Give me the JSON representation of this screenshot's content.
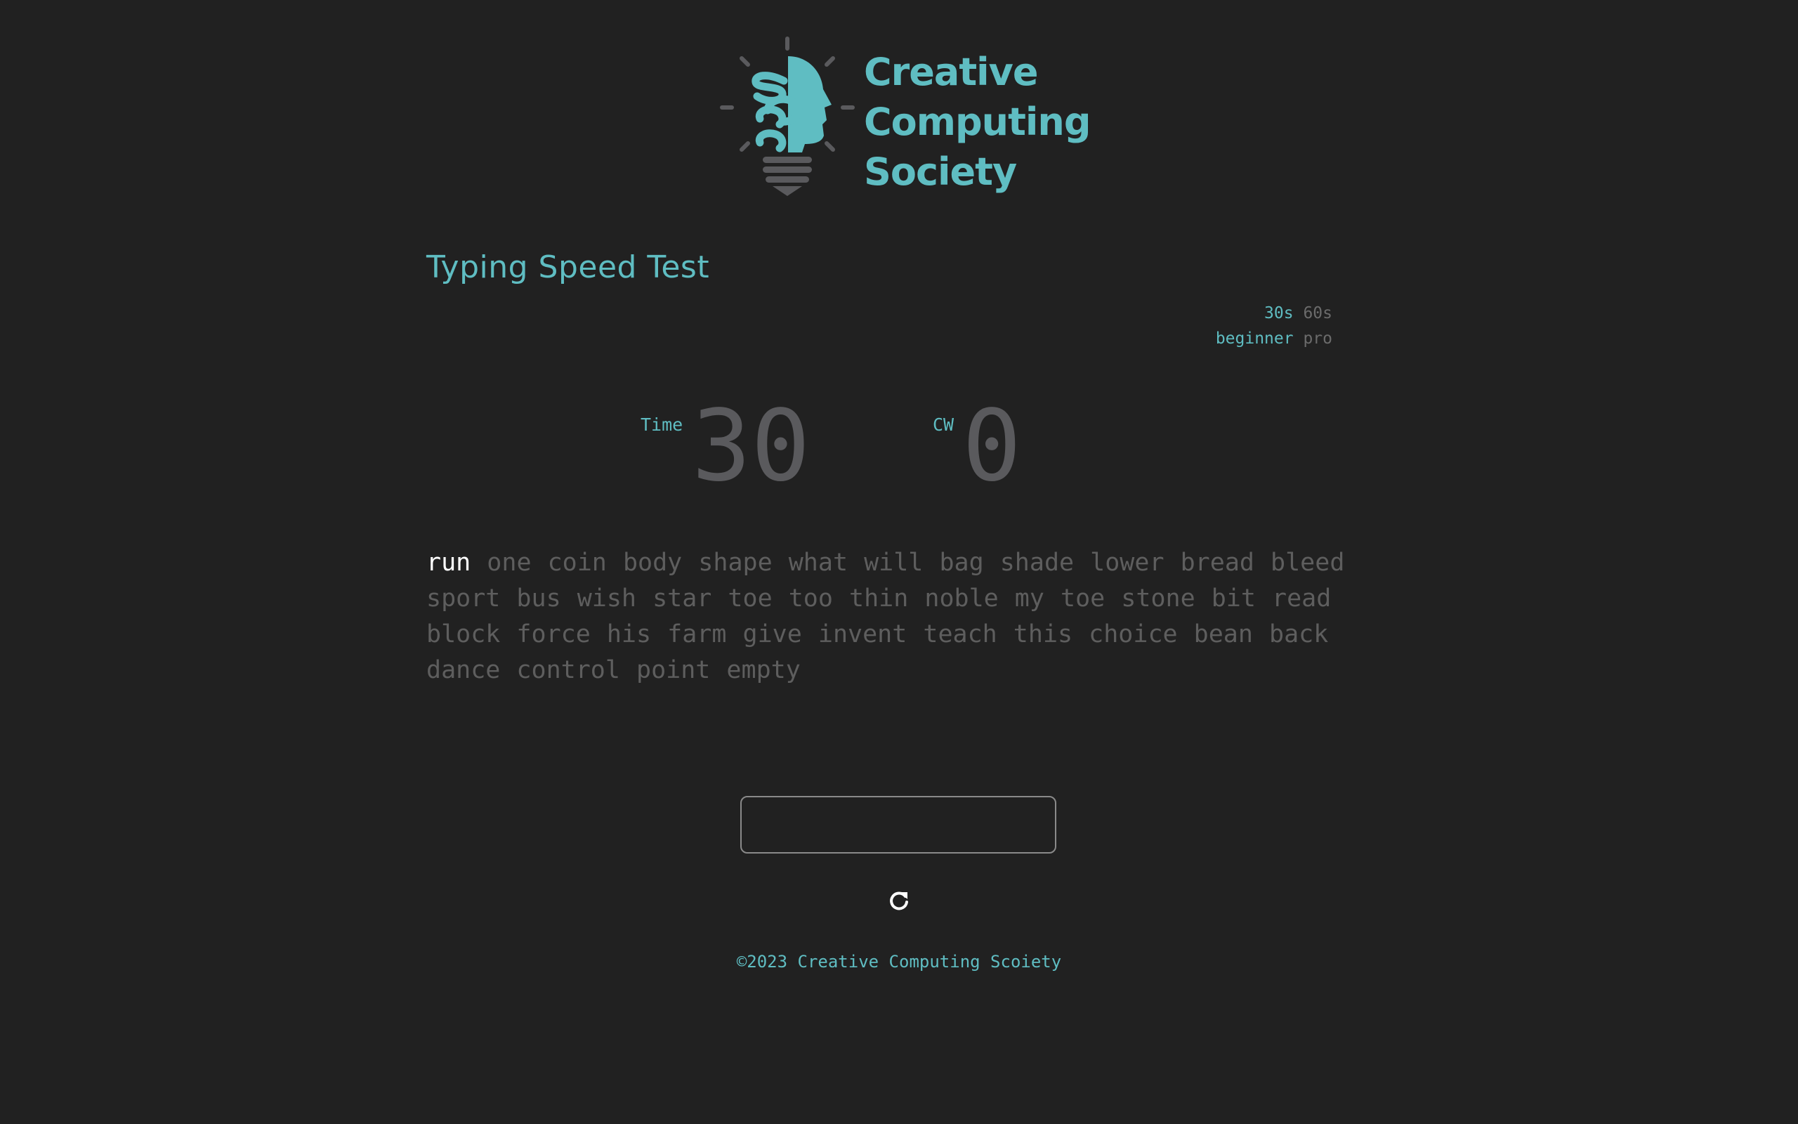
{
  "logo": {
    "icon": "lightbulb-head-icon",
    "mark": "CCS",
    "lines": [
      "Creative",
      "Computing",
      "Society"
    ]
  },
  "title": "Typing Speed Test",
  "options": {
    "durations": [
      "30s",
      "60s"
    ],
    "levels": [
      "beginner",
      "pro"
    ],
    "active_duration": "30s",
    "active_level": "beginner"
  },
  "stats": {
    "time_label": "Time",
    "time_value": "30",
    "cw_label": "CW",
    "cw_value": "0"
  },
  "words": {
    "current": "run",
    "remaining": "one coin body shape what will bag shade lower bread bleed sport bus wish star toe too thin noble my toe stone bit read block force his farm give invent teach this choice bean back dance control point empty"
  },
  "input": {
    "value": ""
  },
  "restart": {
    "icon": "restart-icon"
  },
  "footer": "©2023 Creative Computing Scoiety",
  "colors": {
    "background": "#212121",
    "accent": "#5fbdc2",
    "muted_text": "#5e5e5e",
    "current_word": "#ffffff"
  }
}
